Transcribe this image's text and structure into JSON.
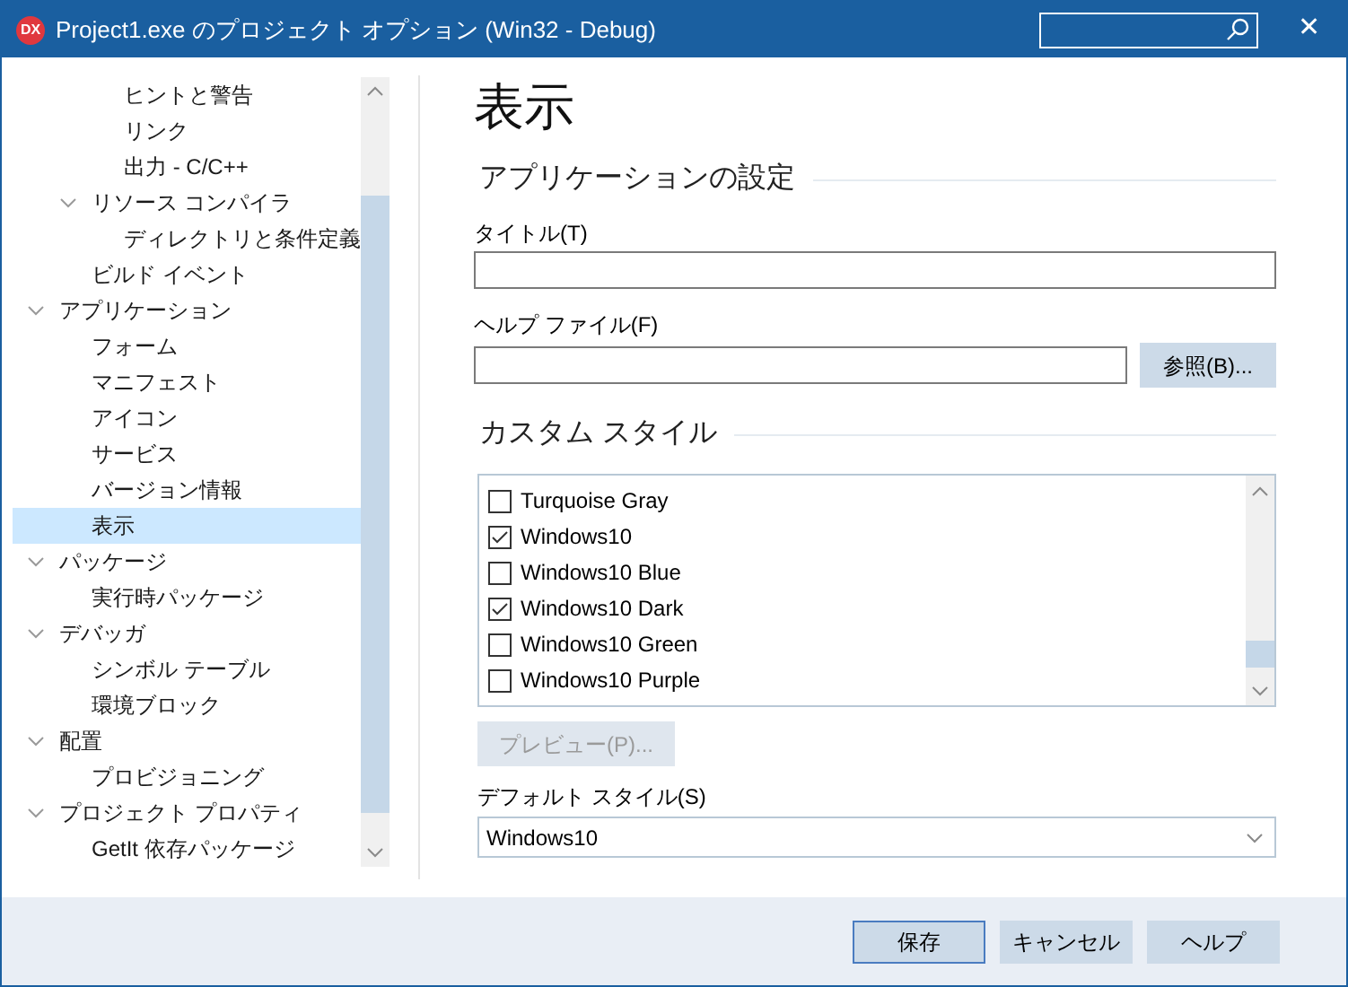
{
  "window": {
    "title": "Project1.exe のプロジェクト オプション  (Win32 - Debug)",
    "logo": "DX",
    "close": "✕"
  },
  "tree": [
    {
      "children": [
        {
          "children": [
            {
              "label": "ヒントと警告",
              "selected": false
            },
            {
              "label": "リンク",
              "selected": false
            },
            {
              "label": "出力 - C/C++",
              "selected": false
            }
          ]
        },
        {
          "label": "リソース コンパイラ",
          "expanded": true,
          "selected": false,
          "children": [
            {
              "label": "ディレクトリと条件定義",
              "selected": false
            }
          ]
        },
        {
          "label": "ビルド イベント",
          "selected": false
        }
      ]
    },
    {
      "label": "アプリケーション",
      "expanded": true,
      "selected": false,
      "children": [
        {
          "label": "フォーム",
          "selected": false
        },
        {
          "label": "マニフェスト",
          "selected": false
        },
        {
          "label": "アイコン",
          "selected": false
        },
        {
          "label": "サービス",
          "selected": false
        },
        {
          "label": "バージョン情報",
          "selected": false
        },
        {
          "label": "表示",
          "selected": true
        }
      ]
    },
    {
      "label": "パッケージ",
      "expanded": true,
      "selected": false,
      "children": [
        {
          "label": "実行時パッケージ",
          "selected": false
        }
      ]
    },
    {
      "label": "デバッガ",
      "expanded": true,
      "selected": false,
      "children": [
        {
          "label": "シンボル テーブル",
          "selected": false
        },
        {
          "label": "環境ブロック",
          "selected": false
        }
      ]
    },
    {
      "label": "配置",
      "expanded": true,
      "selected": false,
      "children": [
        {
          "label": "プロビジョニング",
          "selected": false
        }
      ]
    },
    {
      "label": "プロジェクト プロパティ",
      "expanded": true,
      "selected": false,
      "children": [
        {
          "label": "GetIt 依存パッケージ",
          "selected": false
        }
      ]
    }
  ],
  "page": {
    "title": "表示",
    "app_section": "アプリケーションの設定",
    "title_label": "タイトル(T)",
    "help_label": "ヘルプ ファイル(F)",
    "browse_button": "参照(B)...",
    "style_section": "カスタム スタイル",
    "styles": [
      {
        "label": "Turquoise Gray",
        "checked": false
      },
      {
        "label": "Windows10",
        "checked": true
      },
      {
        "label": "Windows10 Blue",
        "checked": false
      },
      {
        "label": "Windows10 Dark",
        "checked": true
      },
      {
        "label": "Windows10 Green",
        "checked": false
      },
      {
        "label": "Windows10 Purple",
        "checked": false
      }
    ],
    "preview_button": {
      "label": "プレビュー(P)...",
      "disabled": true
    },
    "default_label": "デフォルト スタイル(S)",
    "default_value": "Windows10"
  },
  "buttons": [
    {
      "label": "保存",
      "default": true
    },
    {
      "label": "キャンセル",
      "default": false
    },
    {
      "label": "ヘルプ",
      "default": false
    }
  ]
}
